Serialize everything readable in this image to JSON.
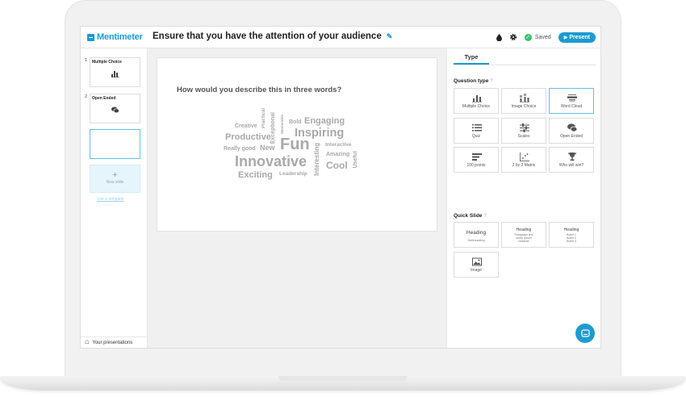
{
  "app": {
    "logo_text": "Mentimeter",
    "presentation_title": "Ensure that you have the attention of your audience",
    "saved_label": "Saved",
    "present_label": "Present",
    "present_icon": "play-icon",
    "accent_color": "#1d9bd0"
  },
  "sidebar": {
    "slides": [
      {
        "number": "1",
        "title": "Multiple Choice",
        "icon": "bar-chart-icon"
      },
      {
        "number": "2",
        "title": "Open Ended",
        "icon": "speech-bubbles-icon"
      }
    ],
    "new_slide_label": "New slide",
    "use_template_label": "Use a template",
    "your_presentations_label": "Your presentations"
  },
  "slide": {
    "question": "How would you describe this in three words?",
    "words": [
      "Creative",
      "Practical",
      "Exceptional",
      "Memorable",
      "Bold",
      "Engaging",
      "Inspiring",
      "Productive",
      "Fun",
      "Interactive",
      "Really good",
      "New",
      "Amazing",
      "Innovative",
      "Interesting",
      "Useful",
      "Cool",
      "Exciting",
      "Leadership"
    ]
  },
  "panel": {
    "tab_label": "Type",
    "question_type_label": "Question type",
    "help_mark": "?",
    "question_types": [
      {
        "label": "Multiple Choice",
        "icon": "bar-chart-icon"
      },
      {
        "label": "Image Choice",
        "icon": "image-bars-icon"
      },
      {
        "label": "Word Cloud",
        "icon": "word-cloud-icon",
        "selected": true
      },
      {
        "label": "Quiz",
        "icon": "quiz-list-icon"
      },
      {
        "label": "Scales",
        "icon": "sliders-icon"
      },
      {
        "label": "Open Ended",
        "icon": "speech-bubbles-icon"
      },
      {
        "label": "100 points",
        "icon": "hundred-points-icon"
      },
      {
        "label": "2 by 2 Matrix",
        "icon": "matrix-icon"
      },
      {
        "label": "Who will win?",
        "icon": "trophy-icon"
      }
    ],
    "quick_slide_label": "Quick Slide",
    "quick_slides": [
      {
        "heading": "Heading",
        "sub": "Subheading"
      },
      {
        "heading": "Heading",
        "sub": "Paragraph text lorem ipsum headline"
      },
      {
        "heading": "Heading",
        "sub": "Bullet 1 Bullet 2 Bullet 3"
      },
      {
        "heading": "",
        "sub": "Image"
      }
    ]
  }
}
